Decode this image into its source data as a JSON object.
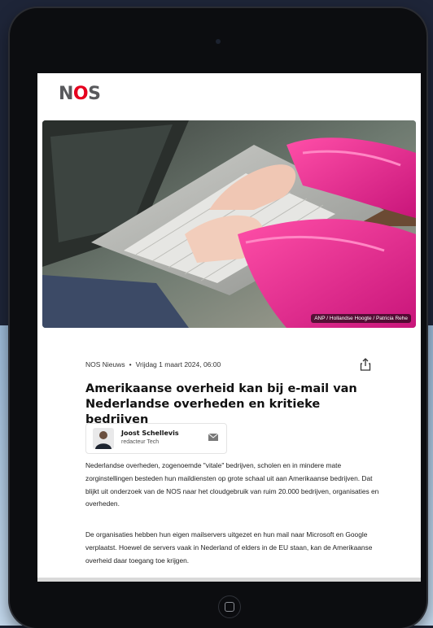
{
  "site": {
    "logo_pre": "N",
    "logo_o": "O",
    "logo_post": "S",
    "brand_red": "#e6001e"
  },
  "hero": {
    "credit": "ANP / Hollandse Hoogte / Patricia Rehe"
  },
  "article": {
    "source": "NOS Nieuws",
    "date": "Vrijdag 1 maart 2024, 06:00",
    "title": "Amerikaanse overheid kan bij e-mail van Nederlandse overheden en kritieke bedrijven",
    "author": {
      "name": "Joost Schellevis",
      "role": "redacteur Tech"
    },
    "paragraphs": [
      "Nederlandse overheden, zogenoemde \"vitale\" bedrijven, scholen en in mindere mate zorginstellingen besteden hun maildiensten op grote schaal uit aan Amerikaanse bedrijven. Dat blijkt uit onderzoek van de NOS naar het cloudgebruik van ruim 20.000 bedrijven, organisaties en overheden.",
      "De organisaties hebben hun eigen mailservers uitgezet en hun mail naar Microsoft en Google verplaatst. Hoewel de servers vaak in Nederland of elders in de EU staan, kan de Amerikaanse overheid daar toegang toe krijgen."
    ]
  },
  "icons": {
    "share": "share-icon",
    "mail": "mail-icon",
    "home": "home-button-icon"
  }
}
